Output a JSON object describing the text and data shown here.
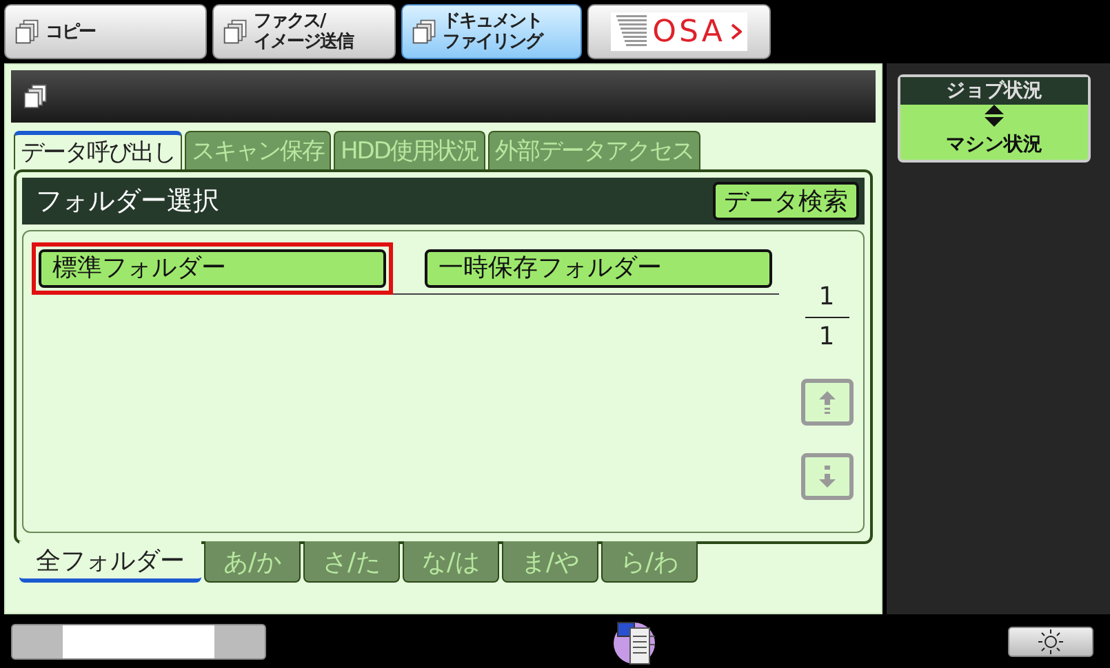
{
  "modes": [
    {
      "kind": "copy",
      "lines": [
        "コピー"
      ],
      "selected": false
    },
    {
      "kind": "fax",
      "lines": [
        "ファクス/",
        "イメージ送信"
      ],
      "selected": false
    },
    {
      "kind": "filing",
      "lines": [
        "ドキュメント",
        "ファイリング"
      ],
      "selected": true
    },
    {
      "kind": "logo",
      "lines": [
        "OSA"
      ],
      "selected": false
    }
  ],
  "tabs": [
    {
      "label": "データ呼び出し",
      "selected": true
    },
    {
      "label": "スキャン保存",
      "selected": false
    },
    {
      "label": "HDD使用状況",
      "selected": false
    },
    {
      "label": "外部データアクセス",
      "selected": false
    }
  ],
  "panel": {
    "title": "フォルダー選択",
    "search_button": "データ検索"
  },
  "folders": [
    {
      "label": "標準フォルダー",
      "selected": true
    },
    {
      "label": "一時保存フォルダー",
      "selected": false
    }
  ],
  "pager": {
    "current": "1",
    "total": "1"
  },
  "index_tabs": [
    {
      "label": "全フォルダー",
      "selected": true
    },
    {
      "label": "あ/か",
      "selected": false
    },
    {
      "label": "さ/た",
      "selected": false
    },
    {
      "label": "な/は",
      "selected": false
    },
    {
      "label": "ま/や",
      "selected": false
    },
    {
      "label": "ら/わ",
      "selected": false
    }
  ],
  "job_status": {
    "top": "ジョブ状況",
    "bottom": "マシン状況"
  }
}
